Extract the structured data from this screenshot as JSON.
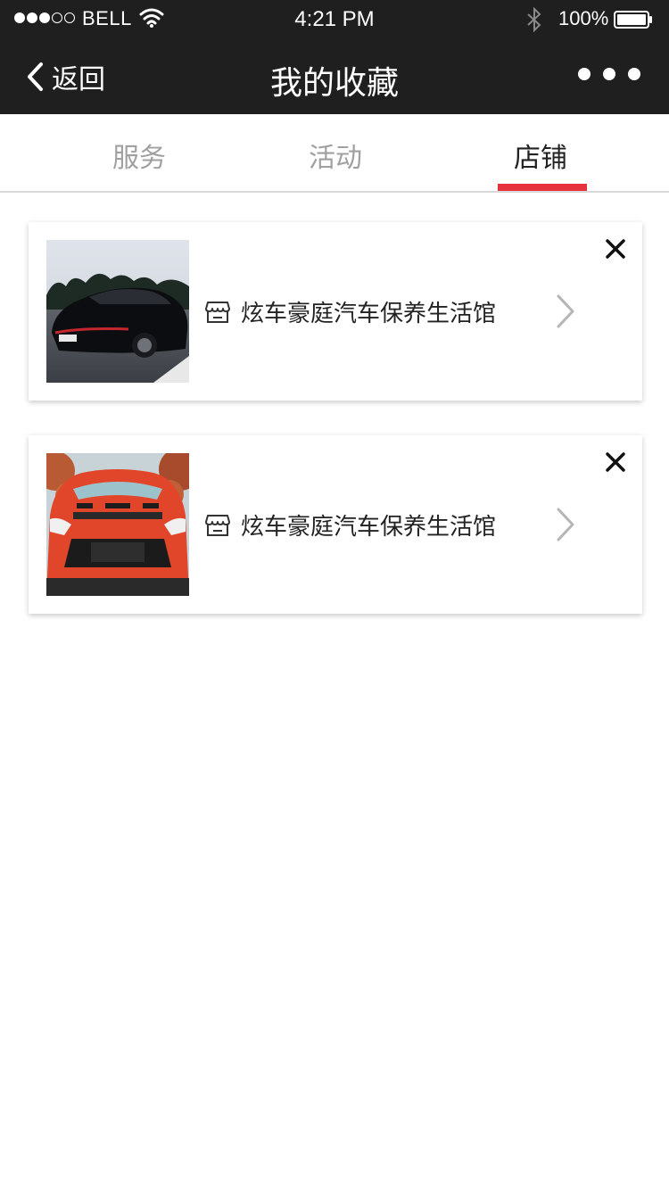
{
  "status_bar": {
    "carrier": "BELL",
    "time": "4:21 PM",
    "battery": "100%",
    "icons": [
      "signal-dots",
      "wifi-icon",
      "bluetooth-icon",
      "battery-icon"
    ]
  },
  "nav": {
    "back_label": "返回",
    "title": "我的收藏",
    "icons": [
      "back-chevron-icon",
      "more-icon"
    ]
  },
  "tabs": [
    {
      "label": "服务",
      "active": false
    },
    {
      "label": "活动",
      "active": false
    },
    {
      "label": "店铺",
      "active": true
    }
  ],
  "colors": {
    "header_bg": "#1f1f1f",
    "tab_underline": "#e5323b",
    "tab_inactive": "#a0a0a0",
    "tab_active": "#222222"
  },
  "favorites": [
    {
      "name": "炫车豪庭汽车保养生活馆",
      "image": "black-sports-car-photo",
      "icons": [
        "store-icon",
        "chevron-right-icon",
        "close-icon"
      ]
    },
    {
      "name": "炫车豪庭汽车保养生活馆",
      "image": "red-sports-car-photo",
      "icons": [
        "store-icon",
        "chevron-right-icon",
        "close-icon"
      ]
    }
  ]
}
